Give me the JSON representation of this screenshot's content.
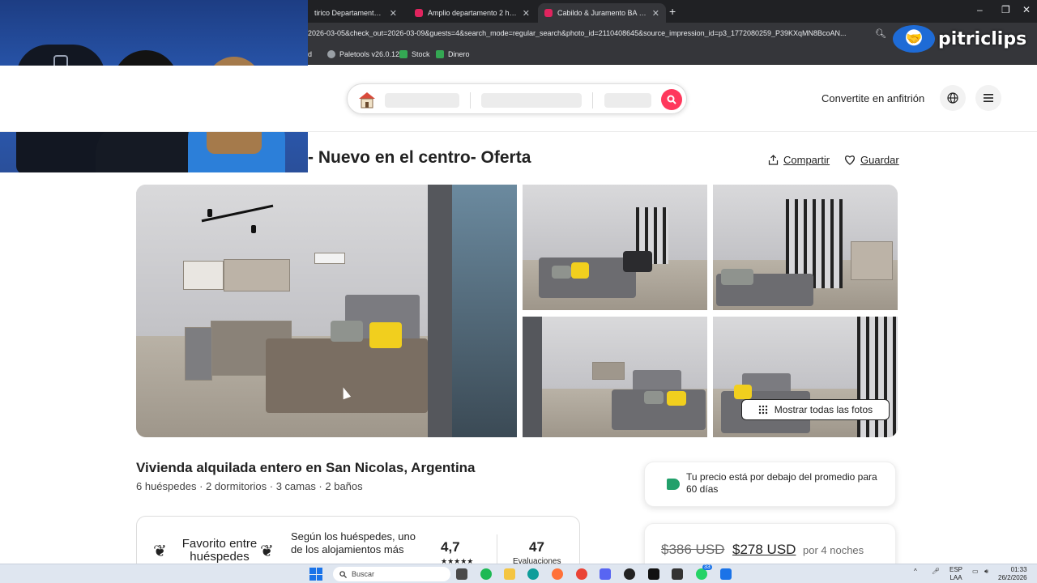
{
  "browser": {
    "tabs": [
      {
        "title": "tirico Departamento - Depa",
        "active": false
      },
      {
        "title": "Amplio departamento 2 hab @",
        "active": false
      },
      {
        "title": "Cabildo & Juramento BA Suite",
        "active": true
      }
    ],
    "new_tab_icon": "plus-icon",
    "url": "2026-03-05&check_out=2026-03-09&guests=4&search_mode=regular_search&photo_id=2110408645&source_impression_id=p3_1772080259_P39KXqMN8BcoAN...",
    "bookmarks": [
      {
        "label": "d",
        "color": "#8ab4f8"
      },
      {
        "label": "Paletools v26.0.12",
        "color": "#9aa0a6"
      },
      {
        "label": "Stock",
        "color": "#34a853"
      },
      {
        "label": "Dinero",
        "color": "#34a853"
      }
    ]
  },
  "overlay": {
    "brand": "pitriclips"
  },
  "header": {
    "host_link": "Convertite en anfitrión",
    "globe_icon": "globe-icon",
    "menu_icon": "menu-icon",
    "search_icon": "search-icon"
  },
  "listing": {
    "title": "- Nuevo en el centro- Oferta",
    "share_label": "Compartir",
    "save_label": "Guardar",
    "show_all_photos": "Mostrar todas las fotos",
    "subtitle": "Vivienda alquilada entero en San Nicolas, Argentina",
    "details": "6 huéspedes · 2 dormitorios · 3 camas · 2 baños"
  },
  "favorite": {
    "label": "Favorito entre huéspedes",
    "description": "Según los huéspedes, uno de los alojamientos más",
    "rating": "4,7",
    "stars": "★★★★★",
    "reviews_count": "47",
    "reviews_label": "Evaluaciones"
  },
  "price_tip": {
    "text": "Tu precio está por debajo del promedio para 60 días",
    "accent": "#22a06b"
  },
  "price": {
    "old": "$386 USD",
    "new": "$278 USD",
    "per": "por 4 noches",
    "brand_color": "#ff385c"
  },
  "taskbar": {
    "search_placeholder": "Buscar",
    "lang_top": "ESP",
    "lang_bottom": "LAA",
    "time": "01:33",
    "date": "26/2/2026",
    "badge": "33"
  }
}
